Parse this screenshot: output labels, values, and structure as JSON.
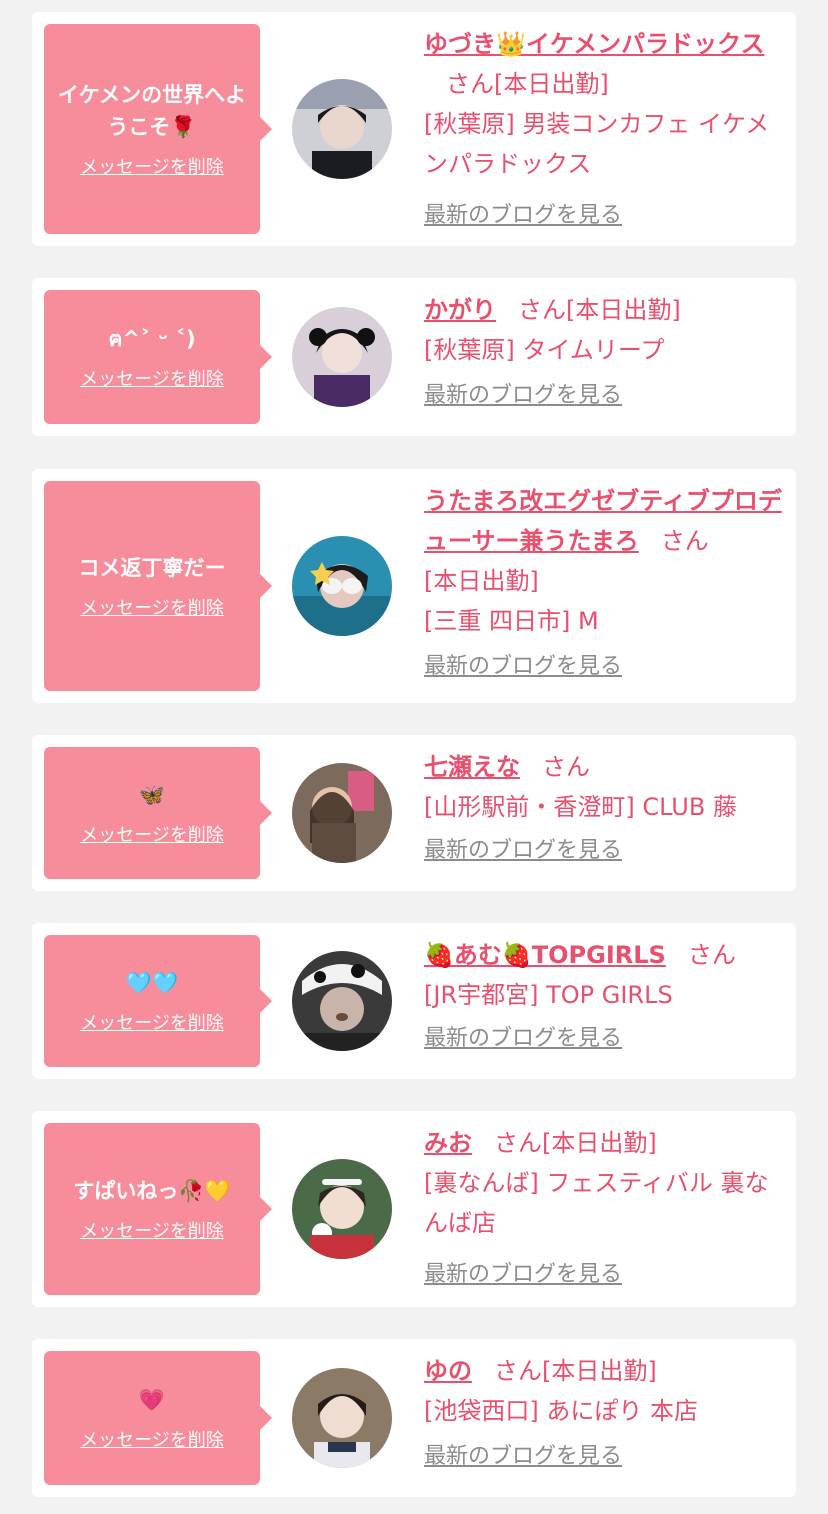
{
  "san_label": "さん",
  "delete_label": "メッセージを削除",
  "blog_label": "最新のブログを見る",
  "items": [
    {
      "message": "イケメンの世界へようこそ🌹",
      "name": "ゆづき👑イケメンパラドックス",
      "status": "[本日出勤]",
      "shop": "[秋葉原] 男装コンカフェ イケメンパラドックス"
    },
    {
      "message": "ฅ^˃ ᵕ ˂)",
      "name": "かがり",
      "status": "[本日出勤]",
      "shop": "[秋葉原] タイムリープ"
    },
    {
      "message": "コメ返丁寧だー",
      "name": "うたまろ改エグゼブティブプロデューサー兼うたまろ",
      "status": "[本日出勤]",
      "shop": "[三重 四日市] M"
    },
    {
      "message": "🦋",
      "name": "七瀬えな",
      "status": "",
      "shop": "[山形駅前・香澄町] CLUB 藤"
    },
    {
      "message": "🩵🩵",
      "name": "🍓あむ🍓TOPGIRLS",
      "status": "",
      "shop": "[JR宇都宮] TOP GIRLS"
    },
    {
      "message": "すぱいねっ🥀💛",
      "name": "みお",
      "status": "[本日出勤]",
      "shop": "[裏なんば] フェスティバル 裏なんば店"
    },
    {
      "message": "💗",
      "name": "ゆの",
      "status": "[本日出勤]",
      "shop": "[池袋西口] あにぽり 本店"
    }
  ]
}
